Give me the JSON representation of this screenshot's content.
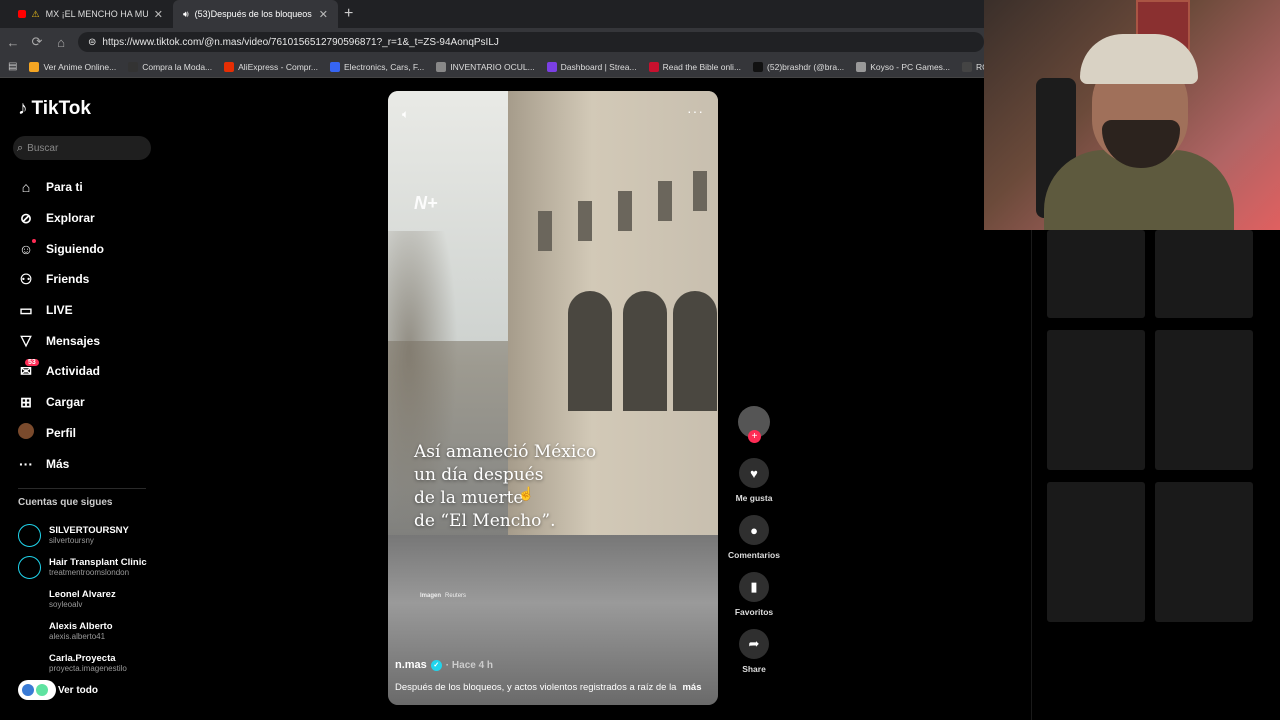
{
  "browser": {
    "tabs": [
      {
        "label": "MX ¡EL MENCHO HA MUERTO! (",
        "active": false
      },
      {
        "label": "(53)Después de los bloqueos",
        "active": true
      }
    ],
    "url": "https://www.tiktok.com/@n.mas/video/7610156512790596871?_r=1&_t=ZS-94AonqPsILJ",
    "bookmarks": [
      {
        "label": "Ver Anime Online...",
        "color": "#f5a623"
      },
      {
        "label": "Compra la Moda...",
        "color": "#333333"
      },
      {
        "label": "AliExpress - Compr...",
        "color": "#e62e04"
      },
      {
        "label": "Electronics, Cars, F...",
        "color": "#3665f3"
      },
      {
        "label": "INVENTARIO OCUL...",
        "color": "#888888"
      },
      {
        "label": "Dashboard | Strea...",
        "color": "#7b3fe4"
      },
      {
        "label": "Read the Bible onli...",
        "color": "#c8102e"
      },
      {
        "label": "(52)brashdr (@bra...",
        "color": "#111111"
      },
      {
        "label": "Koyso - PC Games...",
        "color": "#999999"
      },
      {
        "label": "RO",
        "color": "#444444"
      }
    ]
  },
  "tiktok": {
    "logo": "TikTok",
    "search_placeholder": "Buscar",
    "menu": [
      {
        "label": "Para ti",
        "icon": "⌂"
      },
      {
        "label": "Explorar",
        "icon": "⊘"
      },
      {
        "label": "Siguiendo",
        "icon": "☺"
      },
      {
        "label": "Friends",
        "icon": "⚇"
      },
      {
        "label": "LIVE",
        "icon": "▭"
      },
      {
        "label": "Mensajes",
        "icon": "▽"
      },
      {
        "label": "Actividad",
        "icon": "✉",
        "badge": "53"
      },
      {
        "label": "Cargar",
        "icon": "⊞"
      },
      {
        "label": "Perfil",
        "icon": ""
      },
      {
        "label": "Más",
        "icon": "···"
      }
    ],
    "following_title": "Cuentas que sigues",
    "following": [
      {
        "name": "SILVERTOURSNY",
        "handle": "silvertoursny",
        "live": true
      },
      {
        "name": "Hair Transplant Clinic",
        "handle": "treatmentroomslondon",
        "live": true
      },
      {
        "name": "Leonel Alvarez",
        "handle": "soyleoalv",
        "live": false
      },
      {
        "name": "Alexis Alberto",
        "handle": "alexis.alberto41",
        "live": false
      },
      {
        "name": "Carla.Proyecta",
        "handle": "proyecta.imagenestilo",
        "live": false
      }
    ],
    "see_all": "Ver todo"
  },
  "video": {
    "logo_text": "N+",
    "caption": "Así amaneció México\nun día después\nde la muerte\nde “El Mencho”.",
    "credit_label": "Imagen",
    "credit_source": "Reuters",
    "author": "n.mas",
    "time": "· Hace 4 h",
    "description": "Después de los bloqueos, y actos violentos registrados a raíz de la",
    "more": "más"
  },
  "actions": [
    {
      "label": "Me gusta",
      "icon": "♥"
    },
    {
      "label": "Comentarios",
      "icon": "●"
    },
    {
      "label": "Favoritos",
      "icon": "▮"
    },
    {
      "label": "Share",
      "icon": "➦"
    }
  ]
}
